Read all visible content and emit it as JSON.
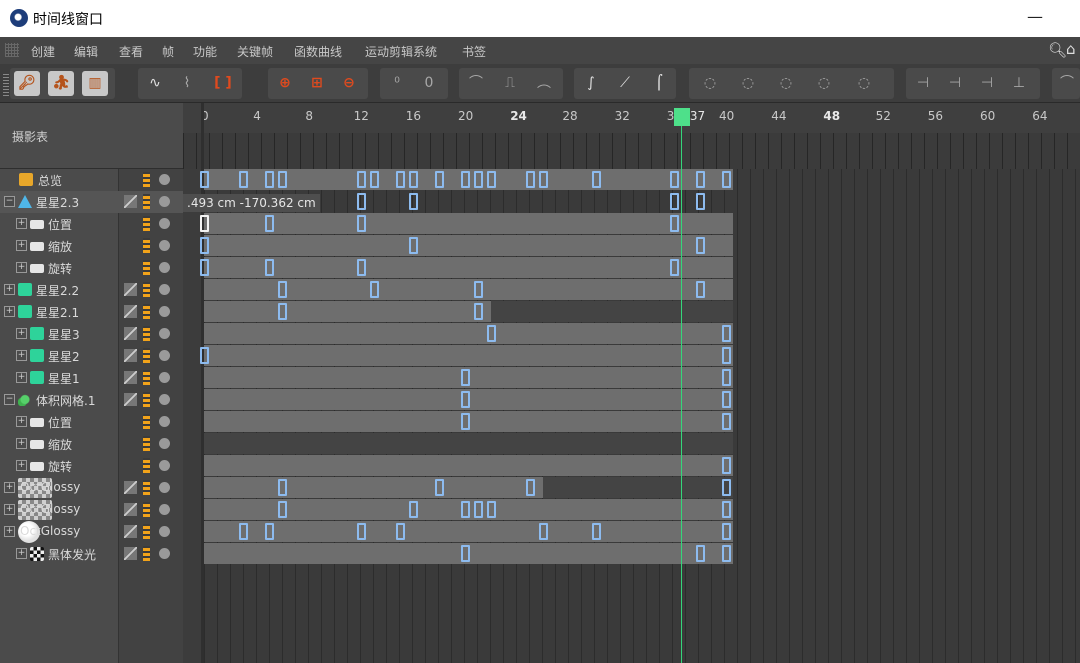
{
  "window": {
    "title": "时间线窗口",
    "minimize": "—"
  },
  "menu": [
    "创建",
    "编辑",
    "查看",
    "帧",
    "功能",
    "关键帧",
    "函数曲线",
    "运动剪辑系统",
    "书签"
  ],
  "menu_search_icon": "search-icon",
  "menu_home_icon": "home-icon",
  "toolbar_groups": [
    [
      "key-mode-icon",
      "run-icon",
      "film-icon"
    ],
    [
      "wave-icon",
      "curve-track-icon",
      "bracket-icon"
    ],
    [
      "add-key-icon",
      "add-key-multiple-icon",
      "remove-key-icon"
    ],
    [
      "zero-icon",
      "zero-offset-icon"
    ],
    [
      "ease-peak-icon",
      "ease-step-icon",
      "ease-arch-icon"
    ],
    [
      "spline-s-icon",
      "spline-in-icon",
      "spline-out-icon"
    ],
    [
      "key-tangent-1-icon",
      "key-tangent-2-icon",
      "key-tangent-3-icon",
      "key-tangent-4-icon",
      "key-tangent-5-icon"
    ],
    [
      "lock-1-icon",
      "lock-2-icon",
      "lock-3-icon",
      "lock-4-icon"
    ],
    [
      "overflow-icon"
    ]
  ],
  "left": {
    "title": "摄影表"
  },
  "ruler": {
    "labels": [
      "0",
      "4",
      "8",
      "12",
      "16",
      "20",
      "24",
      "28",
      "32",
      "36",
      "40",
      "44",
      "48",
      "52",
      "56",
      "60",
      "64"
    ],
    "bold": [
      "24",
      "48"
    ],
    "current_frame": "37"
  },
  "tooltip": ".493 cm   -170.362 cm",
  "tracks": [
    {
      "label": "总览",
      "depth": 0,
      "icon": "folder",
      "exp": false,
      "cols": "bd",
      "band": "light"
    },
    {
      "label": "星星2.3",
      "depth": 0,
      "icon": "cone",
      "exp": "-",
      "cols": "sbd",
      "band": "none"
    },
    {
      "label": "位置",
      "depth": 1,
      "icon": "smallfolder",
      "exp": "+",
      "cols": "bd",
      "band": "light"
    },
    {
      "label": "缩放",
      "depth": 1,
      "icon": "smallfolder",
      "exp": "+",
      "cols": "bd",
      "band": "light"
    },
    {
      "label": "旋转",
      "depth": 1,
      "icon": "smallfolder",
      "exp": "+",
      "cols": "bd",
      "band": "light"
    },
    {
      "label": "星星2.2",
      "depth": 0,
      "icon": "cube",
      "exp": "+",
      "cols": "sbd",
      "band": "light"
    },
    {
      "label": "星星2.1",
      "depth": 0,
      "icon": "cube",
      "exp": "+",
      "cols": "sbd",
      "band": "split"
    },
    {
      "label": "星星3",
      "depth": 1,
      "icon": "cube",
      "exp": "+",
      "cols": "sbd",
      "band": "light"
    },
    {
      "label": "星星2",
      "depth": 1,
      "icon": "cube",
      "exp": "+",
      "cols": "sbd",
      "band": "light"
    },
    {
      "label": "星星1",
      "depth": 1,
      "icon": "cube",
      "exp": "+",
      "cols": "sbd",
      "band": "light"
    },
    {
      "label": "体积网格.1",
      "depth": 0,
      "icon": "vol",
      "exp": "-",
      "cols": "sbd",
      "band": "light"
    },
    {
      "label": "位置",
      "depth": 1,
      "icon": "smallfolder",
      "exp": "+",
      "cols": "bd",
      "band": "light"
    },
    {
      "label": "缩放",
      "depth": 1,
      "icon": "smallfolder",
      "exp": "+",
      "cols": "bd",
      "band": "dark"
    },
    {
      "label": "旋转",
      "depth": 1,
      "icon": "smallfolder",
      "exp": "+",
      "cols": "bd",
      "band": "light"
    },
    {
      "label": "OctGlossy",
      "depth": 0,
      "icon": "mat",
      "exp": "+",
      "cols": "sbd",
      "band": "splitlate"
    },
    {
      "label": "OctGlossy",
      "depth": 0,
      "icon": "mat",
      "exp": "+",
      "cols": "sbd",
      "band": "light"
    },
    {
      "label": "OctGlossy",
      "depth": 0,
      "icon": "matwhite",
      "exp": "+",
      "cols": "sbd",
      "band": "light"
    },
    {
      "label": "黑体发光",
      "depth": 1,
      "icon": "check",
      "exp": "+",
      "cols": "sbd",
      "band": "light"
    }
  ],
  "keys": [
    [
      0,
      3,
      5,
      6,
      12,
      13,
      15,
      16,
      18,
      20,
      21,
      22,
      25,
      26,
      30,
      36,
      38,
      40
    ],
    [
      12,
      16,
      36,
      38
    ],
    [
      0,
      5,
      12,
      36
    ],
    [
      0,
      16,
      38
    ],
    [
      0,
      5,
      12,
      36
    ],
    [
      6,
      13,
      21,
      38
    ],
    [
      6,
      21
    ],
    [
      22,
      40
    ],
    [
      0,
      40
    ],
    [
      20,
      40
    ],
    [
      20,
      40
    ],
    [
      20,
      40
    ],
    [],
    [
      40
    ],
    [
      6,
      18,
      25,
      40
    ],
    [
      6,
      16,
      20,
      21,
      22,
      40
    ],
    [
      3,
      5,
      12,
      15,
      26,
      30,
      40
    ],
    [
      20,
      38,
      40
    ]
  ],
  "white_keys": [
    [
      2,
      0
    ]
  ],
  "colors": {
    "key": "#8dbbef",
    "playhead": "#34d67a",
    "band": "#6e6e6e",
    "accent": "#f2a31a"
  }
}
